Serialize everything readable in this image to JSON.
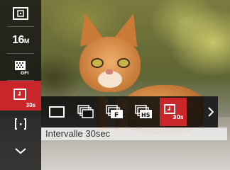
{
  "sidebar": {
    "items": [
      {
        "icon": "metering-icon"
      },
      {
        "label": "16",
        "label_suffix": "M"
      },
      {
        "icon": "dust-removal-off-icon"
      },
      {
        "icon": "self-timer-icon",
        "sub": "30s",
        "selected": true
      },
      {
        "icon": "focus-point-icon"
      },
      {
        "icon": "chevron-down-icon"
      }
    ]
  },
  "submenu": {
    "options": [
      {
        "name": "single-shot-icon"
      },
      {
        "name": "continuous-shot-icon"
      },
      {
        "name": "fast-continuous-shot-icon",
        "badge": "F"
      },
      {
        "name": "high-speed-continuous-shot-icon",
        "badge": "HS"
      },
      {
        "name": "interval-30sec-icon",
        "badge": "30s",
        "selected": true
      }
    ],
    "description": "Intervalle 30sec"
  },
  "colors": {
    "selected": "#c9262c",
    "panel": "#141414"
  }
}
